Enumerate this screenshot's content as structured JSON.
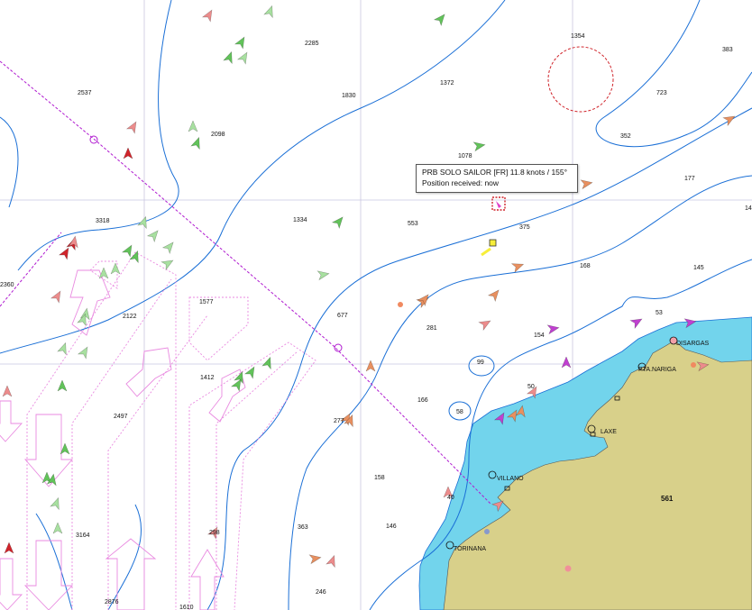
{
  "colors": {
    "water": "#ffffff",
    "shallow": "#72d4ec",
    "land": "#d8d08a",
    "contour": "#1a6fd6",
    "route": "#b01bd0",
    "tss": "#e98ae0",
    "grid": "#c9c6e0"
  },
  "tooltip": {
    "line1": "PRB SOLO SAILOR [FR] 11.8 knots / 155°",
    "line2": "Position received: now"
  },
  "depth_soundings": [
    "2285",
    "1354",
    "383",
    "2537",
    "1830",
    "1372",
    "723",
    "2098",
    "1078",
    "352",
    "177",
    "14",
    "3318",
    "1334",
    "553",
    "375",
    "168",
    "145",
    "2360",
    "2122",
    "1577",
    "677",
    "53",
    "281",
    "154",
    "99",
    "1412",
    "166",
    "2497",
    "50",
    "58",
    "277",
    "158",
    "40",
    "3164",
    "363",
    "146",
    "298",
    "2876",
    "1610",
    "246"
  ],
  "places": [
    "DISARGAS",
    "PTA.NARIGA",
    "LAXE",
    "VILLANO",
    "TORINANA"
  ],
  "summit": "561"
}
